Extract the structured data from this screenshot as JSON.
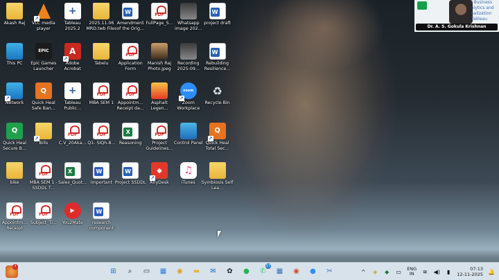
{
  "desktop_icons": [
    {
      "label": "Akash Raj",
      "icon": "user-folder-icon",
      "type": "folder"
    },
    {
      "label": "VLC media player",
      "icon": "vlc-icon",
      "type": "vlc"
    },
    {
      "label": "Tableau 2025.2",
      "icon": "tableau-icon",
      "type": "tableau"
    },
    {
      "label": "2025.11.06 MRD.twb Files",
      "icon": "folder-icon",
      "type": "folder"
    },
    {
      "label": "Amendment of the Orig...",
      "icon": "word-icon",
      "type": "word"
    },
    {
      "label": "FullPage_S...",
      "icon": "pdf-icon",
      "type": "pdf"
    },
    {
      "label": "Whatsapp image 202...",
      "icon": "image-icon",
      "type": "img"
    },
    {
      "label": "project draft",
      "icon": "word-icon",
      "type": "word"
    },
    {
      "label": "This PC",
      "icon": "this-pc-icon",
      "type": "pc"
    },
    {
      "label": "Epic Games Launcher",
      "icon": "epic-games-icon",
      "type": "epic"
    },
    {
      "label": "Adobe Acrobat",
      "icon": "adobe-acrobat-icon",
      "type": "acrobat"
    },
    {
      "label": "Tabelu",
      "icon": "folder-icon",
      "type": "folder"
    },
    {
      "label": "Application Form",
      "icon": "pdf-icon",
      "type": "pdf"
    },
    {
      "label": "Manish Raj Photo.jpeg",
      "icon": "photo-icon",
      "type": "photo"
    },
    {
      "label": "Recording 2025-09...",
      "icon": "recording-icon",
      "type": "img"
    },
    {
      "label": "Rebuilding Resilience...",
      "icon": "word-icon",
      "type": "word"
    },
    {
      "label": "Network",
      "icon": "network-icon",
      "type": "network"
    },
    {
      "label": "Quick Heal Safe Ban...",
      "icon": "quick-heal-icon",
      "type": "qh"
    },
    {
      "label": "Tableau Public...",
      "icon": "tableau-icon",
      "type": "tableau"
    },
    {
      "label": "MBA SEM 1",
      "icon": "pdf-icon",
      "type": "pdf"
    },
    {
      "label": "Appointm... Receipt da...",
      "icon": "pdf-icon",
      "type": "pdf"
    },
    {
      "label": "Asphalt Legen...",
      "icon": "asphalt-icon",
      "type": "asphalt"
    },
    {
      "label": "Zoom Workplace",
      "icon": "zoom-icon",
      "type": "zoom"
    },
    {
      "label": "Recycle Bin",
      "icon": "recycle-bin-icon",
      "type": "recycle"
    },
    {
      "label": "Quick Heal Secure B...",
      "icon": "quick-heal-browser-icon",
      "type": "qhg"
    },
    {
      "label": "Bills",
      "icon": "folder-icon",
      "type": "folder"
    },
    {
      "label": "C.V_20Aka...",
      "icon": "pdf-icon",
      "type": "pdf"
    },
    {
      "label": "Q1- SIQh-8...",
      "icon": "pdf-icon",
      "type": "pdf"
    },
    {
      "label": "Reasoning",
      "icon": "excel-icon",
      "type": "excel"
    },
    {
      "label": "Project Guidelines...",
      "icon": "pdf-icon",
      "type": "pdf"
    },
    {
      "label": "Control Panel",
      "icon": "control-panel-icon",
      "type": "cp"
    },
    {
      "label": "Quick Heal Total Sec...",
      "icon": "quick-heal-total-icon",
      "type": "qh"
    },
    {
      "label": "bike",
      "icon": "folder-icon",
      "type": "folder"
    },
    {
      "label": "MBA SEM 1 - SSDDL T...",
      "icon": "pdf-icon",
      "type": "pdf"
    },
    {
      "label": "Sales_Quot...",
      "icon": "excel-icon",
      "type": "excel"
    },
    {
      "label": "Important",
      "icon": "word-icon",
      "type": "word"
    },
    {
      "label": "Project SSDDL",
      "icon": "word-icon",
      "type": "word"
    },
    {
      "label": "AnyDesk",
      "icon": "anydesk-icon",
      "type": "anydesk"
    },
    {
      "label": "iTunes",
      "icon": "itunes-icon",
      "type": "itunes"
    },
    {
      "label": "Symbiosis Self Lea...",
      "icon": "folder-icon",
      "type": "folder"
    },
    {
      "label": "Appointm... Receipt",
      "icon": "pdf-icon",
      "type": "pdf"
    },
    {
      "label": "Subject_Ti...",
      "icon": "pdf-icon",
      "type": "pdf"
    },
    {
      "label": "You2Mate",
      "icon": "you2mate-icon",
      "type": "you2"
    },
    {
      "label": "research component",
      "icon": "word-icon",
      "type": "word"
    }
  ],
  "webcam": {
    "name": "Dr. A. S. Gokula Krishnan",
    "background_text": "l Business alytics and ualization Tableau"
  },
  "taskbar": {
    "widget_badge": "7",
    "apps": [
      {
        "icon": "windows-start-icon",
        "glyph": "⊞",
        "color": "#1a73e8"
      },
      {
        "icon": "search-icon",
        "glyph": "⌕",
        "color": "#222222"
      },
      {
        "icon": "task-view-icon",
        "glyph": "▭",
        "color": "#333333"
      },
      {
        "icon": "widgets-icon",
        "glyph": "▦",
        "color": "#2b7bd8"
      },
      {
        "icon": "chrome-icon",
        "glyph": "◉",
        "color": "#e0a020"
      },
      {
        "icon": "file-explorer-icon",
        "glyph": "▬",
        "color": "#e8b53a"
      },
      {
        "icon": "mail-icon",
        "glyph": "✉",
        "color": "#1b6ec2"
      },
      {
        "icon": "chatgpt-icon",
        "glyph": "✿",
        "color": "#222222"
      },
      {
        "icon": "spotify-icon",
        "glyph": "●",
        "color": "#1db954"
      },
      {
        "icon": "whatsapp-icon",
        "glyph": "✆",
        "color": "#25d366",
        "badge": "17"
      },
      {
        "icon": "calculator-icon",
        "glyph": "▦",
        "color": "#3a6fb8"
      },
      {
        "icon": "chrome-profile-icon",
        "glyph": "◉",
        "color": "#d84a2a"
      },
      {
        "icon": "zoom-icon",
        "glyph": "●",
        "color": "#2d8cff"
      },
      {
        "icon": "snipping-tool-icon",
        "glyph": "✂",
        "color": "#3a6fb8"
      }
    ],
    "language_top": "ENG",
    "language_bottom": "IN",
    "time": "07:13",
    "date": "12-11-2025"
  }
}
